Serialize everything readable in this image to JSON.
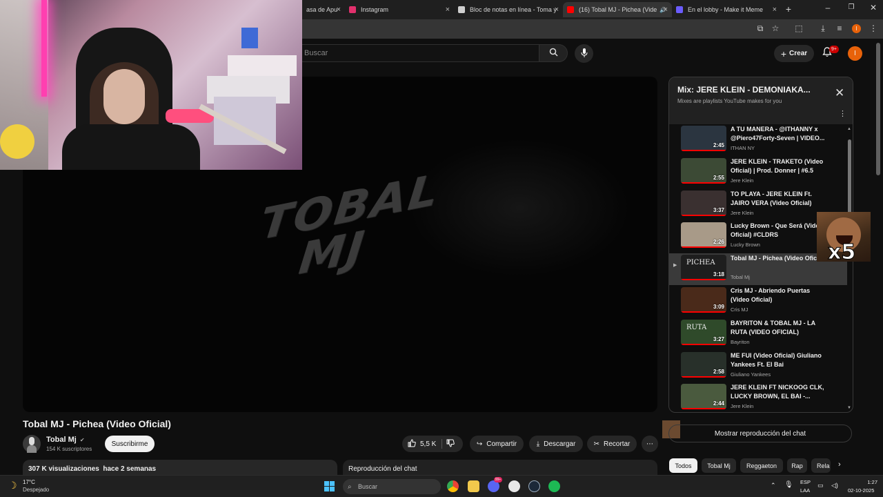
{
  "browser": {
    "tabs": [
      {
        "label": "asa de Apu",
        "favicon_color": "#4285f4"
      },
      {
        "label": "Instagram",
        "favicon_color": "#e1306c"
      },
      {
        "label": "Bloc de notas en línea - Toma y",
        "favicon_color": "#cfcfcf"
      },
      {
        "label": "(16) Tobal MJ - Pichea (Vide",
        "favicon_color": "#ff0000"
      },
      {
        "label": "En el lobby - Make it Meme",
        "favicon_color": "#6b5cff"
      }
    ],
    "new_tab_icon": "plus-icon",
    "window_controls": [
      "minimize-icon",
      "restore-icon",
      "close-icon"
    ]
  },
  "youtube_header": {
    "search_placeholder": "Buscar",
    "create_label": "Crear",
    "notifications_badge": "9+",
    "user_initial": "I"
  },
  "video": {
    "overlay_logo_line1": "TOBAL",
    "overlay_logo_line2": "MJ",
    "title": "Tobal MJ - Pichea (Video Oficial)",
    "channel": "Tobal Mj",
    "subscribers": "154 K suscriptores",
    "subscribe_label": "Suscribirme",
    "likes": "5,5 K",
    "share_label": "Compartir",
    "download_label": "Descargar",
    "clip_label": "Recortar",
    "views_date": "307 K visualizaciones  hace 2 semanas",
    "chat_replay_label": "Reproducción del chat"
  },
  "playlist": {
    "title": "Mix: JERE KLEIN - DEMONIAKA...",
    "subtitle": "Mixes are playlists YouTube makes for you",
    "items": [
      {
        "title": "A TU MANERA - @ITHANNY x @Piero47Forty-Seven | VIDEO...",
        "channel": "ITHAN NY",
        "duration": "2:45",
        "thumb_color": "#2b3540"
      },
      {
        "title": "JERE KLEIN - TRAKETO (Video Oficial) | Prod. Donner | #6.5",
        "channel": "Jere Klein",
        "duration": "2:55",
        "thumb_color": "#3c4a35"
      },
      {
        "title": "TO PLAYA - JERE KLEIN Ft. JAIRO VERA (Video Oficial)",
        "channel": "Jere Klein",
        "duration": "3:37",
        "thumb_color": "#3a3030"
      },
      {
        "title": "Lucky Brown - Que Será (Video Oficial) #CLDRS",
        "channel": "Lucky Brown",
        "duration": "2:26",
        "thumb_color": "#a89a88"
      },
      {
        "title": "Tobal MJ - Pichea (Video Oficial)",
        "channel": "Tobal Mj",
        "duration": "3:18",
        "thumb_color": "#1e1e1e",
        "thumb_text": "PICHEA",
        "active": true
      },
      {
        "title": "Cris MJ - Abriendo Puertas (Video Oficial)",
        "channel": "Cris MJ",
        "duration": "3:09",
        "thumb_color": "#4a2a1a"
      },
      {
        "title": "BAYRITON & TOBAL MJ - LA RUTA (VIDEO OFICIAL)",
        "channel": "Bayriton",
        "duration": "3:27",
        "thumb_color": "#2f4a2a",
        "thumb_text": "RUTA"
      },
      {
        "title": "ME FUI (Video Oficial) Giuliano Yankees Ft. El Bai",
        "channel": "Giuliano Yankees",
        "duration": "2:58",
        "thumb_color": "#28302a"
      },
      {
        "title": "JERE KLEIN FT NICKOOG CLK, LUCKY BROWN, EL BAI -...",
        "channel": "Jere Klein",
        "duration": "2:44",
        "thumb_color": "#4a5a3e"
      }
    ],
    "show_chat_label": "Mostrar reproducción del chat"
  },
  "meme_overlay": {
    "text": "x5"
  },
  "chips": [
    "Todos",
    "Tobal Mj",
    "Reggaeton",
    "Rap",
    "Rela"
  ],
  "taskbar": {
    "temperature": "17°C",
    "weather": "Despejado",
    "search_placeholder": "Buscar",
    "notification_badge": "99+",
    "lang1": "ESP",
    "lang2": "LAA",
    "time": "1:27",
    "date": "02-10-2025"
  }
}
